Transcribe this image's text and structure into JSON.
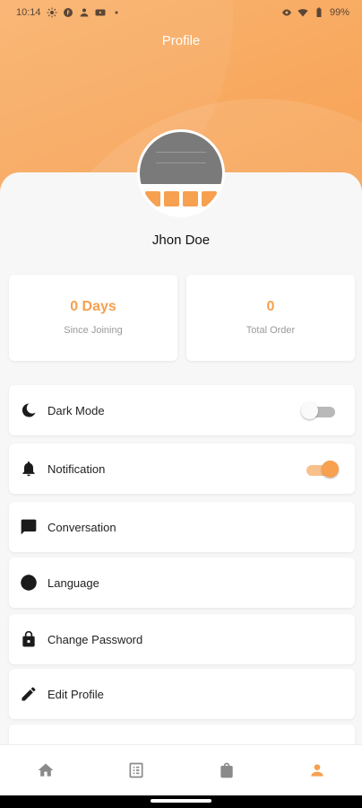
{
  "status_bar": {
    "time": "10:14",
    "left_icons": [
      "brightness-icon",
      "f-app-icon",
      "person-app-icon",
      "youtube-icon",
      "dot-icon"
    ],
    "right_icons": [
      "eye-icon",
      "wifi-icon",
      "battery-icon"
    ],
    "battery": "99%"
  },
  "header": {
    "title": "Profile"
  },
  "profile": {
    "name": "Jhon Doe"
  },
  "stats": [
    {
      "value": "0 Days",
      "label": "Since Joining"
    },
    {
      "value": "0",
      "label": "Total Order"
    }
  ],
  "menu": {
    "dark_mode": {
      "label": "Dark Mode",
      "icon": "moon-icon",
      "toggle": false
    },
    "notification": {
      "label": "Notification",
      "icon": "bell-icon",
      "toggle": true
    },
    "conversation": {
      "label": "Conversation",
      "icon": "chat-icon"
    },
    "language": {
      "label": "Language",
      "icon": "globe-icon"
    },
    "change_password": {
      "label": "Change Password",
      "icon": "lock-icon"
    },
    "edit_profile": {
      "label": "Edit Profile",
      "icon": "pencil-icon"
    }
  },
  "bottom_nav": {
    "items": [
      "home-icon",
      "orders-list-icon",
      "shopping-bag-icon",
      "profile-icon"
    ],
    "active": "profile-icon"
  },
  "colors": {
    "accent": "#f6a050",
    "header_light": "#f9b36f",
    "inactive_icon": "#8a8a8a"
  }
}
